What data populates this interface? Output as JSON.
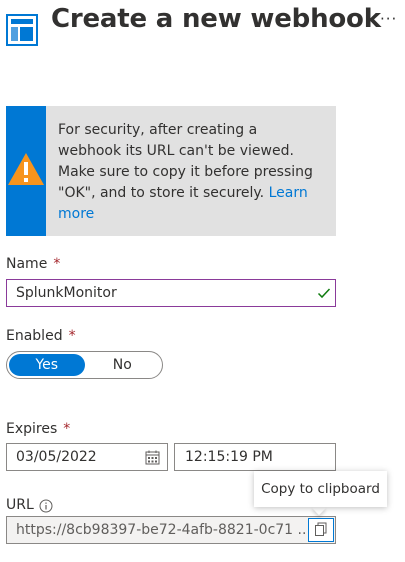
{
  "header": {
    "title": "Create a new webhook",
    "icon": "webhook-blade-icon",
    "more_label": "···"
  },
  "warning": {
    "icon": "warning-icon",
    "text": "For security, after creating a webhook its URL can't be viewed. Make sure to copy it before pressing \"OK\", and to store it securely.",
    "link_text": "Learn more",
    "stripe_color": "#0078d4",
    "icon_color": "#f7941d"
  },
  "name": {
    "label": "Name",
    "required_mark": "*",
    "value": "SplunkMonitor",
    "valid_icon": "check-icon"
  },
  "enabled": {
    "label": "Enabled",
    "required_mark": "*",
    "options": [
      "Yes",
      "No"
    ],
    "selected": "Yes"
  },
  "expires": {
    "label": "Expires",
    "required_mark": "*",
    "date": "03/05/2022",
    "time": "12:15:19 PM",
    "date_icon": "calendar-icon"
  },
  "url": {
    "label": "URL",
    "info_icon": "info-icon",
    "value": "https://8cb98397-be72-4afb-8821-0c71 ...",
    "copy_icon": "copy-icon",
    "tooltip": "Copy to clipboard"
  },
  "colors": {
    "accent": "#0078d4",
    "required": "#a4262c",
    "valid": "#107c10"
  }
}
